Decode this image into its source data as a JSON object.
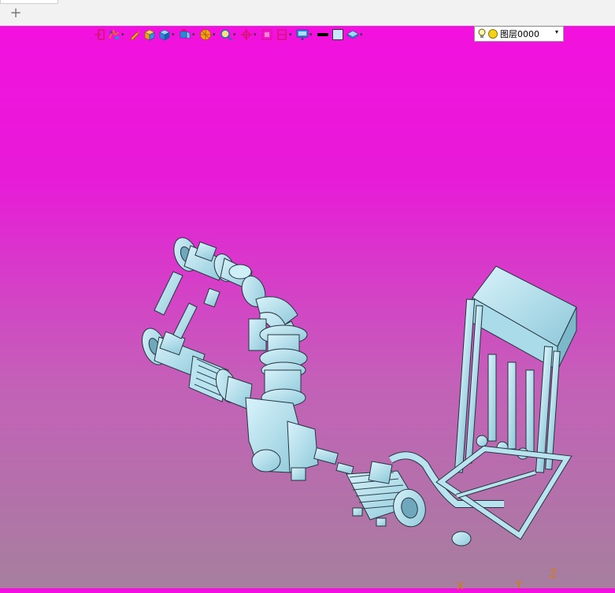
{
  "tabs": {
    "new_tab_label": "+"
  },
  "toolbar": {
    "buttons": [
      {
        "icon": "exit-arrow-icon",
        "caret": false
      },
      {
        "icon": "sketch-tools-icon",
        "caret": true
      },
      {
        "icon": "pencil-icon",
        "caret": false
      },
      {
        "icon": "solid-box-icon",
        "caret": false
      },
      {
        "icon": "cube-view-icon",
        "caret": true
      },
      {
        "icon": "projection-icon",
        "caret": true
      },
      {
        "icon": "render-style-icon",
        "caret": true
      },
      {
        "icon": "zoom-icon",
        "caret": true
      },
      {
        "icon": "rotate-view-icon",
        "caret": true
      },
      {
        "icon": "fit-view-icon",
        "caret": false
      },
      {
        "icon": "section-view-icon",
        "caret": true
      },
      {
        "icon": "display-settings-icon",
        "caret": true
      },
      {
        "icon": "line-color-icon",
        "caret": false
      },
      {
        "icon": "fill-color-icon",
        "caret": false
      },
      {
        "icon": "layer-manager-icon",
        "caret": true
      }
    ]
  },
  "layer": {
    "current": "图层0000",
    "dropdown_glyph": "▾"
  },
  "axes": {
    "z": "Z",
    "x": "X",
    "y": "Y"
  },
  "colors": {
    "steel": "#a9dbe8",
    "outline": "#253540",
    "background_top": "#f40fe0",
    "background_bottom": "#a67f9e"
  }
}
